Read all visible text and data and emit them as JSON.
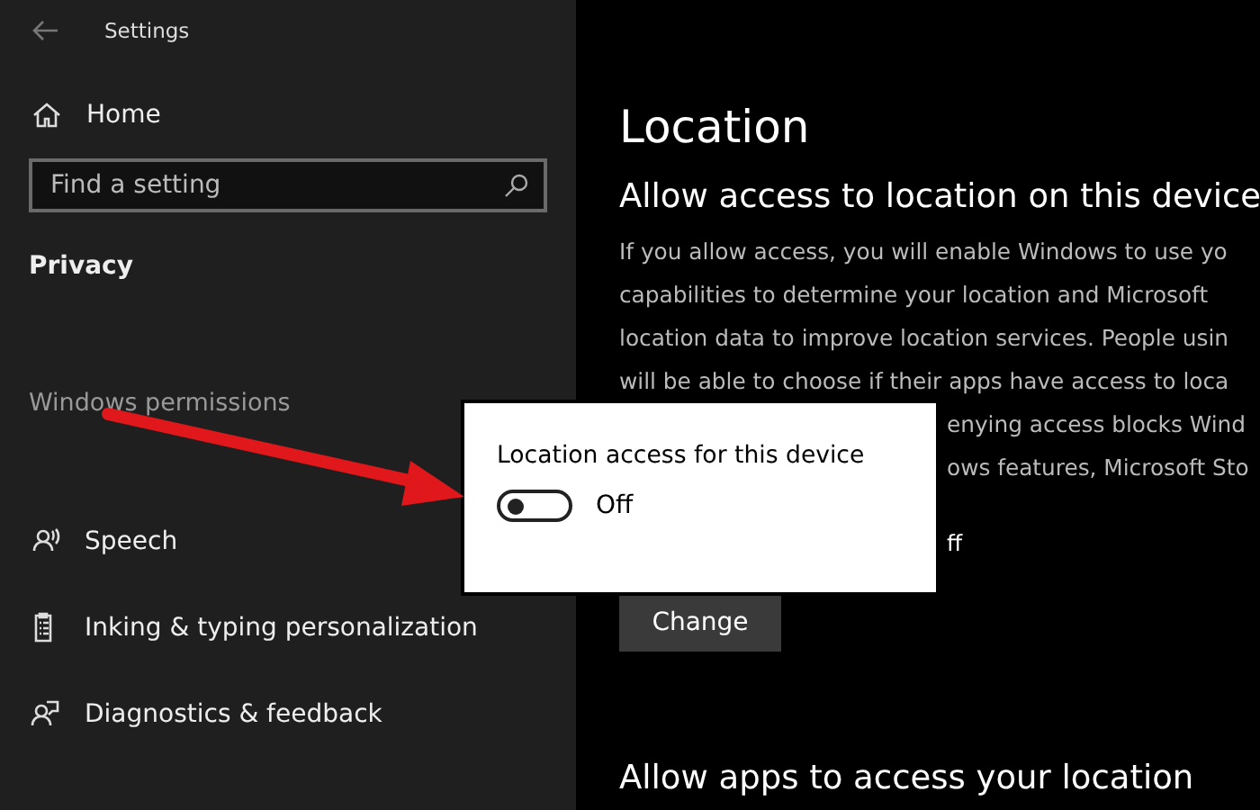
{
  "window": {
    "title": "Settings"
  },
  "sidebar": {
    "home": "Home",
    "search": {
      "placeholder": "Find a setting"
    },
    "category": "Privacy",
    "section": "Windows permissions",
    "items": [
      {
        "label": "Speech",
        "kind": "speech"
      },
      {
        "label": "Inking & typing personalization",
        "kind": "inking"
      },
      {
        "label": "Diagnostics & feedback",
        "kind": "diagnostics"
      }
    ]
  },
  "page": {
    "title": "Location",
    "heading": "Allow access to location on this device",
    "paragraph": [
      {
        "text": "If you allow access, you will enable Windows to use yo",
        "kind": "full"
      },
      {
        "text": "capabilities to determine your location and Microsoft",
        "kind": "full"
      },
      {
        "text": "location data to improve location services. People usin",
        "kind": "full"
      },
      {
        "text": "will be able to choose if their apps have access to loca",
        "kind": "full"
      },
      {
        "text": "enying access blocks Wind",
        "kind": "partial"
      },
      {
        "text": "ows features, Microsoft Sto",
        "kind": "partial"
      }
    ],
    "status": "ff",
    "button": "Change",
    "heading2": "Allow apps to access your location"
  },
  "popup": {
    "label": "Location access for this device",
    "toggle": {
      "on": false,
      "text": "Off"
    }
  }
}
